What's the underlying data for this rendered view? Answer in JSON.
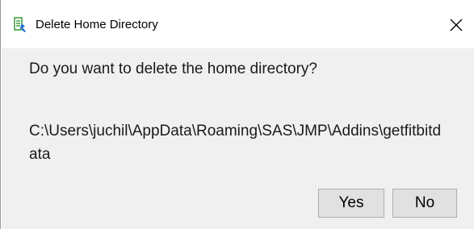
{
  "window": {
    "title": "Delete Home Directory",
    "app_icon": "jmp-addin-icon",
    "close_icon": "close-icon"
  },
  "message": {
    "question": "Do you want to delete the home directory?",
    "path": "C:\\Users\\juchil\\AppData\\Roaming\\SAS\\JMP\\Addins\\getfitbitdata"
  },
  "buttons": {
    "yes_label": "Yes",
    "no_label": "No"
  },
  "colors": {
    "content_bg": "#f0f0f0",
    "button_bg": "#e1e1e1",
    "icon_green": "#3a9c3a",
    "icon_blue": "#1f6fd1"
  }
}
